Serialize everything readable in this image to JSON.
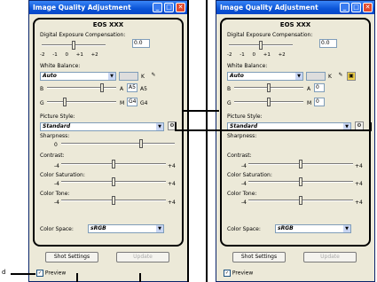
{
  "window_title": "Image Quality Adjustment",
  "camera": "EOS XXX",
  "exposure": {
    "label": "Digital Exposure Compensation:",
    "ticks": [
      "-2",
      "-1",
      "0",
      "+1",
      "+2"
    ],
    "value": "0.0"
  },
  "white_balance": {
    "label": "White Balance:",
    "selected": "Auto",
    "k_label": "K",
    "b_label": "B",
    "a_label": "A",
    "g_label": "G",
    "m_label": "M",
    "left": {
      "a_value": "A5",
      "m_value": "G4"
    },
    "right": {
      "a_value": "0",
      "m_value": "0"
    }
  },
  "picture_style": {
    "label": "Picture Style:",
    "selected": "Standard"
  },
  "sharpness": {
    "label": "Sharpness:",
    "min": "0"
  },
  "contrast": {
    "label": "Contrast:",
    "min": "-4",
    "max": "+4"
  },
  "color_saturation": {
    "label": "Color Saturation:",
    "min": "-4",
    "max": "+4"
  },
  "color_tone": {
    "label": "Color Tone:",
    "min": "-4",
    "max": "+4"
  },
  "color_space": {
    "label": "Color Space:",
    "selected": "sRGB"
  },
  "buttons": {
    "shot_settings": "Shot Settings",
    "update": "Update"
  },
  "preview": {
    "label": "Preview"
  },
  "outside_label": "d"
}
